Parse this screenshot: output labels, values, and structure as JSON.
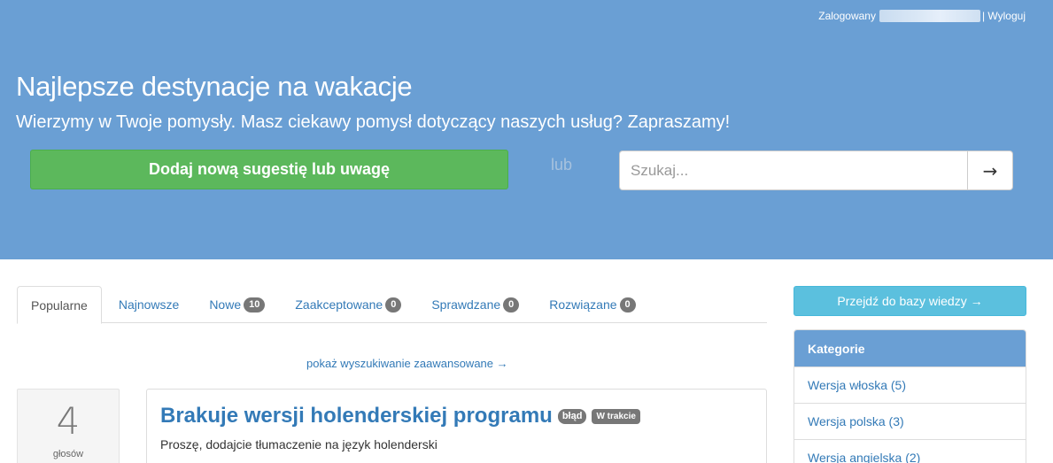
{
  "userbar": {
    "logged_label": "Zalogowany",
    "logout": "| Wyloguj"
  },
  "hero": {
    "title": "Najlepsze destynacje na wakacje",
    "lead": "Wierzymy w Twoje pomysły. Masz ciekawy pomysł dotyczący naszych usług? Zapraszamy!",
    "add_button": "Dodaj nową sugestię lub uwagę",
    "or": "lub",
    "search_placeholder": "Szukaj...",
    "search_button": "→"
  },
  "tabs": [
    {
      "label": "Popularne",
      "count": null
    },
    {
      "label": "Najnowsze",
      "count": null
    },
    {
      "label": "Nowe",
      "count": "10"
    },
    {
      "label": "Zaakceptowane",
      "count": "0"
    },
    {
      "label": "Sprawdzane",
      "count": "0"
    },
    {
      "label": "Rozwiązane",
      "count": "0"
    }
  ],
  "advanced_search": "pokaż wyszukiwanie zaawansowane →",
  "ideas": [
    {
      "votes": "4",
      "votes_label": "głosów",
      "title": "Brakuje wersji holenderskiej programu",
      "labels": [
        "błąd",
        "W trakcie"
      ],
      "description": "Proszę, dodajcie tłumaczenie na język holenderski"
    }
  ],
  "sidebar": {
    "kb_button": "Przejdź do bazy wiedzy →",
    "categories_title": "Kategorie",
    "categories": [
      "Wersja włoska (5)",
      "Wersja polska (3)",
      "Wersja angielska (2)"
    ]
  },
  "colors": {
    "hero": "#6a9fd4",
    "success": "#5cb85c",
    "info": "#5bc0de",
    "link": "#337ab7"
  }
}
